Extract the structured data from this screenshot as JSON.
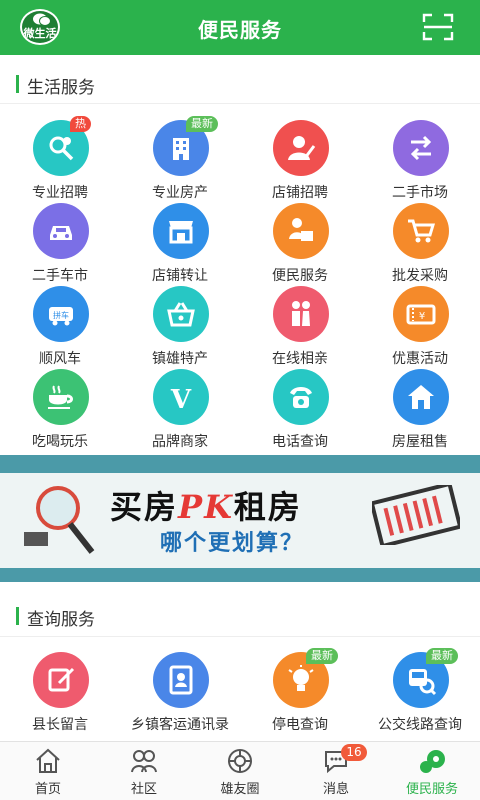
{
  "header": {
    "title": "便民服务",
    "logo_text": "微生活",
    "brand_color": "#2bb24c"
  },
  "sections": {
    "life": {
      "title": "生活服务",
      "items": [
        {
          "label": "专业招聘",
          "icon": "job-search-icon",
          "color": "#27c7c4",
          "badge": "热"
        },
        {
          "label": "专业房产",
          "icon": "building-icon",
          "color": "#4a86e8",
          "badge": "最新"
        },
        {
          "label": "店铺招聘",
          "icon": "person-pen-icon",
          "color": "#f0504f",
          "badge": ""
        },
        {
          "label": "二手市场",
          "icon": "exchange-icon",
          "color": "#8f6ae0",
          "badge": ""
        },
        {
          "label": "二手车市",
          "icon": "car-icon",
          "color": "#7b6fe6",
          "badge": ""
        },
        {
          "label": "店铺转让",
          "icon": "storefront-icon",
          "color": "#2f8fe8",
          "badge": ""
        },
        {
          "label": "便民服务",
          "icon": "delivery-icon",
          "color": "#f58a2a",
          "badge": ""
        },
        {
          "label": "批发采购",
          "icon": "cart-icon",
          "color": "#f58a2a",
          "badge": ""
        },
        {
          "label": "顺风车",
          "icon": "carpool-icon",
          "color": "#2f8fe8",
          "badge": ""
        },
        {
          "label": "镇雄特产",
          "icon": "basket-icon",
          "color": "#27c7c4",
          "badge": ""
        },
        {
          "label": "在线相亲",
          "icon": "couple-icon",
          "color": "#ef5b6e",
          "badge": ""
        },
        {
          "label": "优惠活动",
          "icon": "coupon-icon",
          "color": "#f58a2a",
          "badge": ""
        },
        {
          "label": "吃喝玩乐",
          "icon": "coffee-cup-icon",
          "color": "#3cc274",
          "badge": ""
        },
        {
          "label": "品牌商家",
          "icon": "brand-v-icon",
          "color": "#27c7c4",
          "badge": ""
        },
        {
          "label": "电话查询",
          "icon": "telephone-icon",
          "color": "#27c7c4",
          "badge": ""
        },
        {
          "label": "房屋租售",
          "icon": "house-icon",
          "color": "#2f8fe8",
          "badge": ""
        }
      ]
    },
    "query": {
      "title": "查询服务",
      "items": [
        {
          "label": "县长留言",
          "icon": "edit-note-icon",
          "color": "#ef5b6e",
          "badge": ""
        },
        {
          "label": "乡镇客运通讯录",
          "icon": "contact-book-icon",
          "color": "#4a86e8",
          "badge": ""
        },
        {
          "label": "停电查询",
          "icon": "light-bulb-icon",
          "color": "#f58a2a",
          "badge": "最新"
        },
        {
          "label": "公交线路查询",
          "icon": "bus-search-icon",
          "color": "#2f8fe8",
          "badge": "最新"
        }
      ]
    }
  },
  "banner": {
    "headline_left": "买房",
    "headline_pk": "PK",
    "headline_right": "租房",
    "subline": "哪个更划算？"
  },
  "tabbar": {
    "tabs": [
      {
        "label": "首页",
        "icon": "home-icon"
      },
      {
        "label": "社区",
        "icon": "community-icon"
      },
      {
        "label": "雄友圈",
        "icon": "moments-icon"
      },
      {
        "label": "消息",
        "icon": "message-icon",
        "count": "16"
      },
      {
        "label": "便民服务",
        "icon": "service-icon",
        "active": true
      }
    ]
  }
}
